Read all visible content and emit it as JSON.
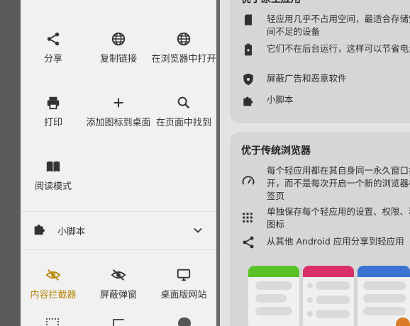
{
  "sheet": {
    "actions": [
      {
        "label": "分享",
        "icon": "share-icon"
      },
      {
        "label": "复制链接",
        "icon": "globe-icon"
      },
      {
        "label": "在浏览器中打开",
        "icon": "globe-icon"
      },
      {
        "label": "打印",
        "icon": "print-icon"
      },
      {
        "label": "添加图标到桌面",
        "icon": "plus-icon"
      },
      {
        "label": "在页面中找到",
        "icon": "search-icon"
      },
      {
        "label": "阅读模式",
        "icon": "book-icon"
      }
    ],
    "scripts_label": "小脚本",
    "toggles": [
      {
        "label": "内容拦截器",
        "icon": "eye-off-icon",
        "active": true
      },
      {
        "label": "屏蔽弹窗",
        "icon": "eye-off-icon",
        "active": false
      },
      {
        "label": "桌面版网站",
        "icon": "monitor-icon",
        "active": false
      }
    ],
    "accent_color": "#b8860b"
  },
  "background": {
    "card1": {
      "title": "优于原生应用",
      "features": [
        {
          "text": "轻应用几乎不占用空间，最适合存储空间不足的设备",
          "icon": "sd-card-icon"
        },
        {
          "text": "它们不在后台运行，这样可以节省电量",
          "icon": "battery-icon"
        },
        {
          "text": "屏蔽广告和恶意软件",
          "icon": "shield-bug-icon"
        },
        {
          "text": "小脚本",
          "icon": "puzzle-icon"
        }
      ]
    },
    "card2": {
      "title": "优于传统浏览器",
      "features": [
        {
          "text": "每个轻应用都在其自身同一永久窗口打开，而不是每次开启一个新的浏览器标签页",
          "icon": "gauge-icon"
        },
        {
          "text": "单独保存每个轻应用的设置、权限、和图标",
          "icon": "grid-icon"
        },
        {
          "text": "从其他 Android 应用分享到轻应用",
          "icon": "share-icon"
        }
      ]
    },
    "mock_colors": [
      "#5ecf2a",
      "#e8336e",
      "#3e7be0"
    ]
  }
}
